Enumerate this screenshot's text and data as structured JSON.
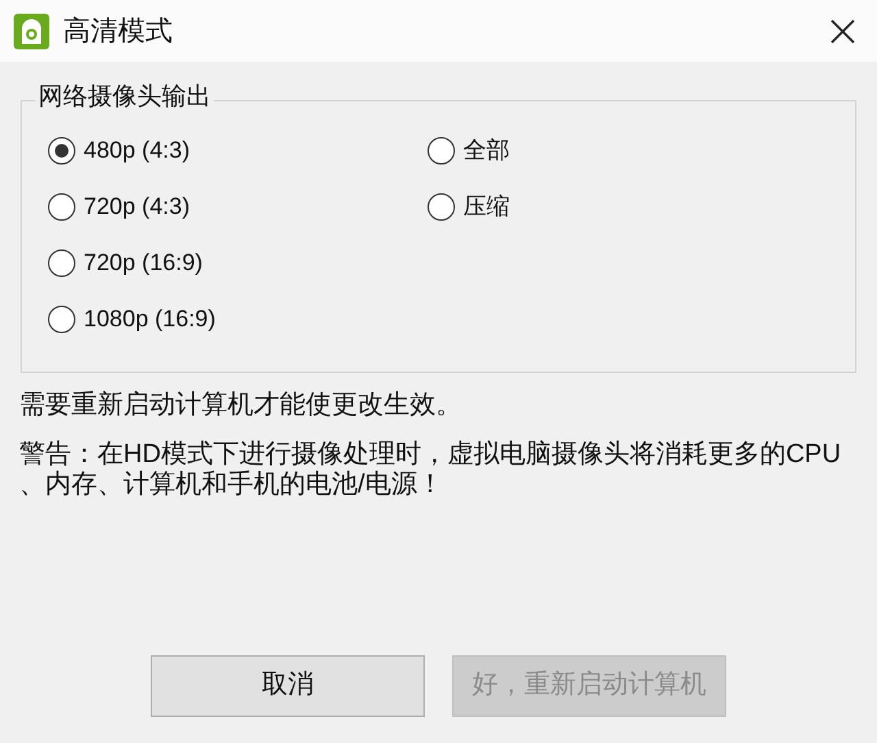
{
  "window": {
    "title": "高清模式"
  },
  "group": {
    "title": "网络摄像头输出",
    "columns": [
      {
        "options": [
          {
            "label": "480p (4:3)",
            "selected": true
          },
          {
            "label": "720p (4:3)",
            "selected": false
          },
          {
            "label": "720p (16:9)",
            "selected": false
          },
          {
            "label": "1080p (16:9)",
            "selected": false
          }
        ]
      },
      {
        "options": [
          {
            "label": "全部",
            "selected": false
          },
          {
            "label": "压缩",
            "selected": false
          }
        ]
      }
    ]
  },
  "notice": "需要重新启动计算机才能使更改生效。",
  "warning": "警告：在HD模式下进行摄像处理时，虚拟电脑摄像头将消耗更多的CPU、内存、计算机和手机的电池/电源！",
  "buttons": [
    {
      "label": "取消",
      "disabled": false
    },
    {
      "label": "好，重新启动计算机",
      "disabled": true
    }
  ]
}
